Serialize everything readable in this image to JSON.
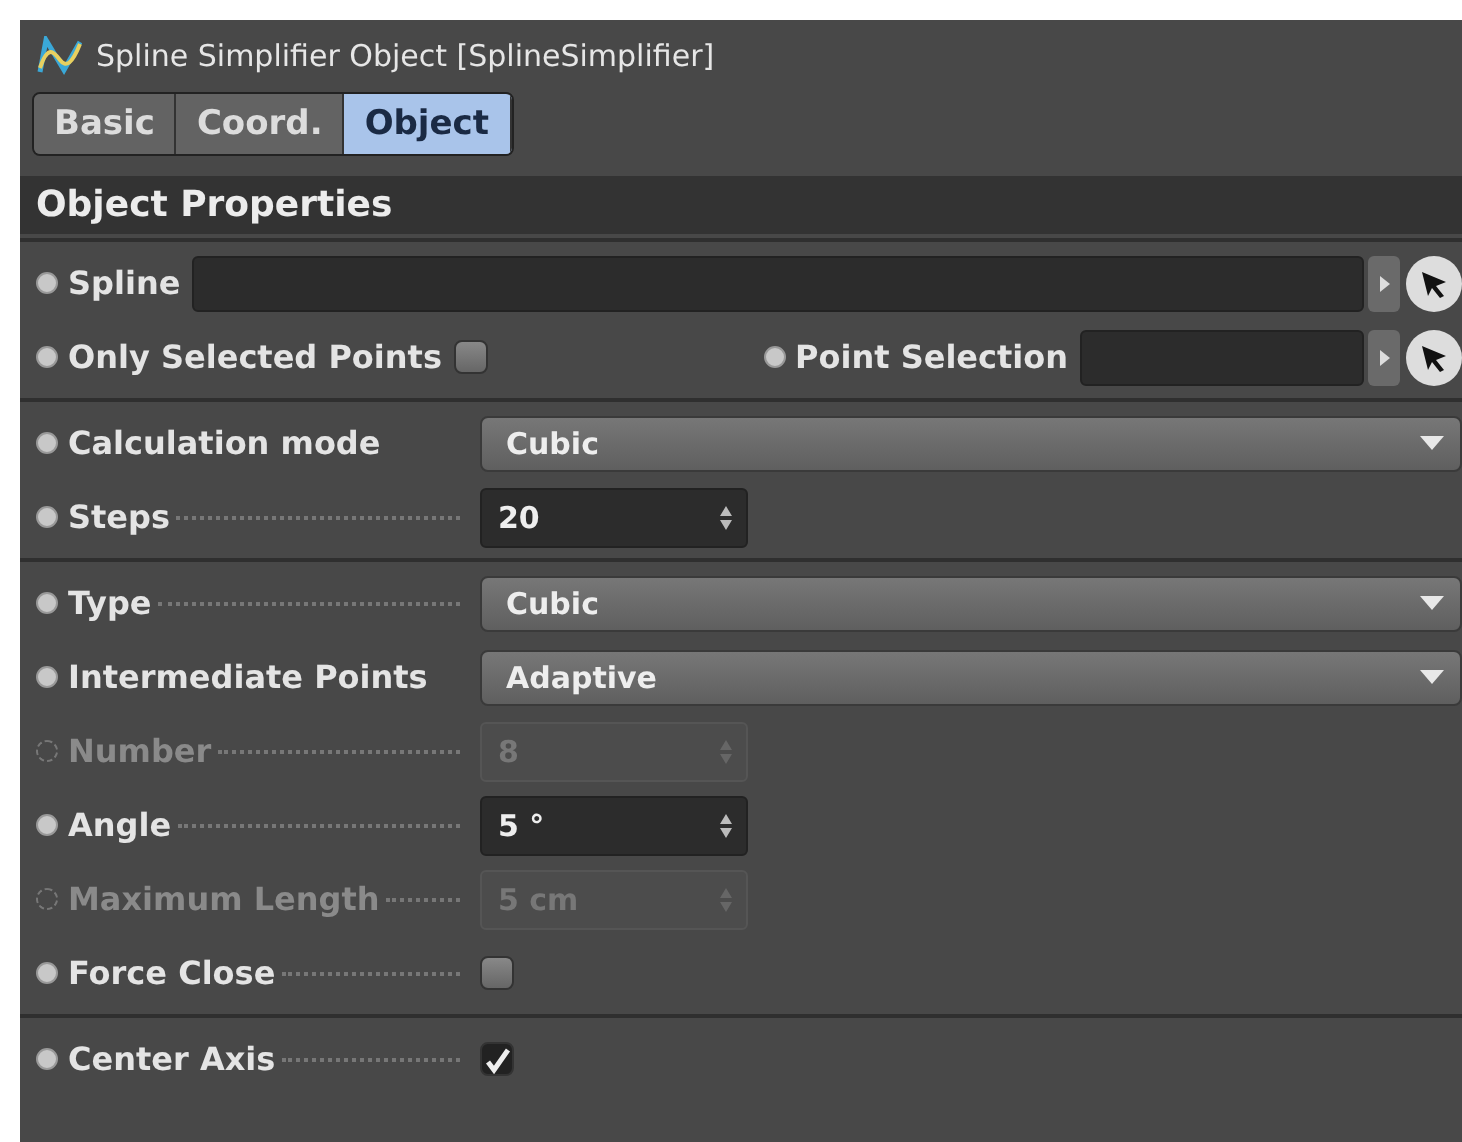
{
  "window": {
    "title": "Spline Simplifier Object [SplineSimplifier]"
  },
  "tabs": [
    {
      "label": "Basic",
      "selected": false
    },
    {
      "label": "Coord.",
      "selected": false
    },
    {
      "label": "Object",
      "selected": true
    }
  ],
  "section_title": "Object Properties",
  "groups": [
    {
      "rows": [
        {
          "params": [
            {
              "kind": "link",
              "label": "Spline",
              "disabled": false,
              "leader": false
            }
          ]
        },
        {
          "params": [
            {
              "kind": "checkbox",
              "label": "Only Selected Points",
              "disabled": false,
              "leader": false,
              "checked": false
            },
            {
              "kind": "link",
              "label": "Point Selection",
              "disabled": false,
              "leader": false
            }
          ]
        }
      ]
    },
    {
      "rows": [
        {
          "params": [
            {
              "kind": "dropdown",
              "label": "Calculation mode",
              "disabled": false,
              "leader": false,
              "value": "Cubic"
            }
          ]
        },
        {
          "params": [
            {
              "kind": "number",
              "label": "Steps",
              "disabled": false,
              "leader": true,
              "value": "20"
            }
          ]
        }
      ]
    },
    {
      "rows": [
        {
          "params": [
            {
              "kind": "dropdown",
              "label": "Type",
              "disabled": false,
              "leader": true,
              "value": "Cubic"
            }
          ]
        },
        {
          "params": [
            {
              "kind": "dropdown",
              "label": "Intermediate Points",
              "disabled": false,
              "leader": false,
              "value": "Adaptive"
            }
          ]
        },
        {
          "params": [
            {
              "kind": "number",
              "label": "Number",
              "disabled": true,
              "leader": true,
              "value": "8"
            }
          ]
        },
        {
          "params": [
            {
              "kind": "number",
              "label": "Angle",
              "disabled": false,
              "leader": true,
              "value": "5 °"
            }
          ]
        },
        {
          "params": [
            {
              "kind": "number",
              "label": "Maximum Length",
              "disabled": true,
              "leader": true,
              "value": "5 cm"
            }
          ]
        },
        {
          "params": [
            {
              "kind": "checkbox",
              "label": "Force Close",
              "disabled": false,
              "leader": true,
              "checked": false
            }
          ]
        }
      ]
    },
    {
      "rows": [
        {
          "params": [
            {
              "kind": "checkbox",
              "label": "Center Axis",
              "disabled": false,
              "leader": true,
              "checked": true
            }
          ]
        }
      ]
    }
  ]
}
